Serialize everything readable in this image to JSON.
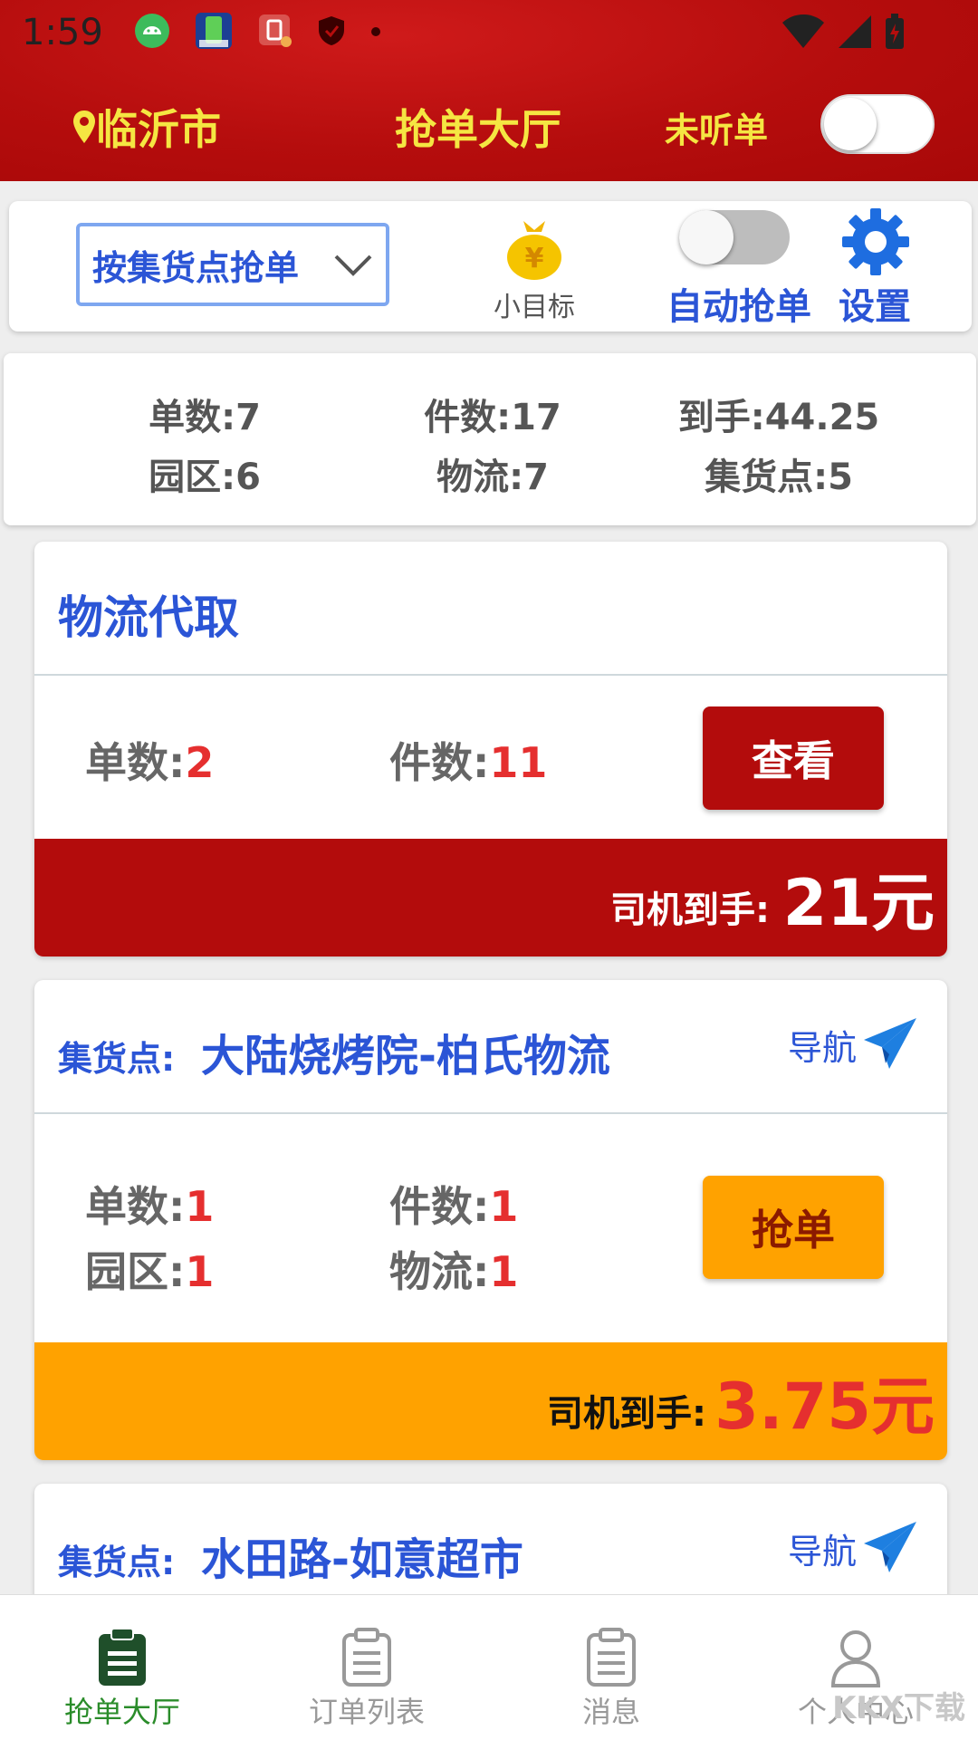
{
  "status_bar": {
    "time": "1:59"
  },
  "header": {
    "city": "临沂市",
    "title": "抢单大厅",
    "listen_status": "未听单",
    "listen_toggle_on": false
  },
  "toolbar": {
    "mode_select": "按集货点抢单",
    "goal_label": "小目标",
    "auto_grab_label": "自动抢单",
    "auto_grab_on": false,
    "settings_label": "设置"
  },
  "summary": {
    "orders": "单数:7",
    "pieces": "件数:17",
    "earnings": "到手:44.25",
    "park": "园区:6",
    "logistics": "物流:7",
    "collection_points": "集货点:5"
  },
  "cards": [
    {
      "title": "物流代取",
      "orders_label": "单数:",
      "orders_value": "2",
      "pieces_label": "件数:",
      "pieces_value": "11",
      "button": "查看",
      "footer_label": "司机到手:",
      "footer_amount": "21元"
    },
    {
      "loc_label": "集货点:",
      "loc_name": "大陆烧烤院-柏氏物流",
      "nav_label": "导航",
      "orders_label": "单数:",
      "orders_value": "1",
      "pieces_label": "件数:",
      "pieces_value": "1",
      "park_label": "园区:",
      "park_value": "1",
      "logistics_label": "物流:",
      "logistics_value": "1",
      "button": "抢单",
      "footer_label": "司机到手:",
      "footer_amount": "3.75元"
    },
    {
      "loc_label": "集货点:",
      "loc_name": "水田路-如意超市",
      "nav_label": "导航"
    }
  ],
  "bottom_nav": [
    {
      "label": "抢单大厅",
      "active": true
    },
    {
      "label": "订单列表",
      "active": false
    },
    {
      "label": "消息",
      "active": false
    },
    {
      "label": "个人中心",
      "active": false
    }
  ],
  "watermark": "KKX下载",
  "colors": {
    "header_red": "#b50d0d",
    "accent_blue": "#2b55d6",
    "header_text_yellow": "#f5e642",
    "highlight_red": "#e52f2f",
    "orange": "#ffa200",
    "active_tab_green": "#2a8c2a"
  }
}
